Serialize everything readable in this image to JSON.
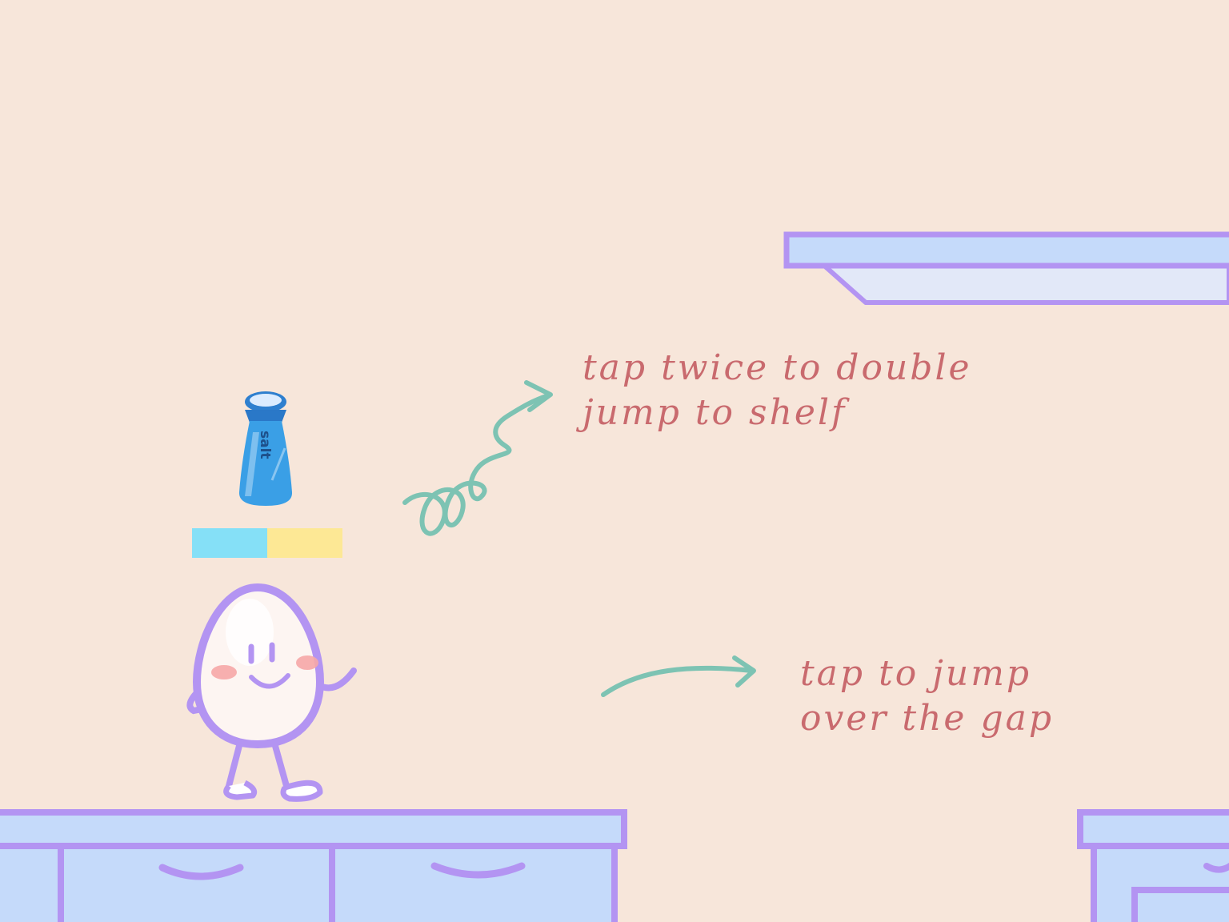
{
  "colors": {
    "background": "#f7e6da",
    "outline": "#b394f2",
    "furniture_fill": "#c5dafa",
    "shelf_underside": "#e2e8f8",
    "arrow": "#7dc3b3",
    "hint_text": "#c96a6e",
    "bar_left": "#85e0f7",
    "bar_right": "#fde895",
    "salt_bottle": "#3a9fe6"
  },
  "hints": {
    "double_jump": [
      "tap twice to double",
      "jump to shelf"
    ],
    "single_jump": [
      "tap to jump",
      "over the gap"
    ]
  },
  "salt": {
    "label": "salt"
  },
  "jump_meter": {
    "left_fraction": 0.5
  }
}
